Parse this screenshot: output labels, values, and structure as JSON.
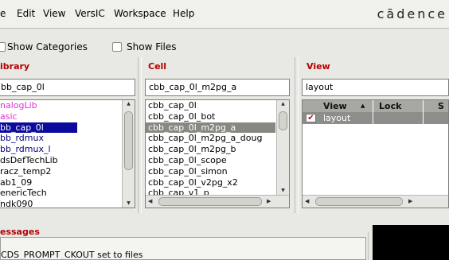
{
  "menubar": {
    "items": [
      "e",
      "Edit",
      "View",
      "VersIC",
      "Workspace",
      "Help"
    ],
    "brand": "cādence"
  },
  "options": {
    "show_categories": "Show Categories",
    "show_files": "Show Files"
  },
  "library": {
    "title": "ibrary",
    "value": "bb_cap_0l",
    "items": [
      "nalogLib",
      "asic",
      "bb_cap_0l",
      "bb_rdmux",
      "bb_rdmux_l",
      "dsDefTechLib",
      "racz_temp2",
      "ab1_09",
      "enericTech",
      "ndk090"
    ]
  },
  "cell": {
    "title": "Cell",
    "value": "cbb_cap_0l_m2pg_a",
    "items": [
      "cbb_cap_0l",
      "cbb_cap_0l_bot",
      "cbb_cap_0l_m2pg_a",
      "cbb_cap_0l_m2pg_a_doug",
      "cbb_cap_0l_m2pg_b",
      "cbb_cap_0l_scope",
      "cbb_cap_0l_simon",
      "cbb_cap_0l_v2pg_x2",
      "cbb_cap_v1_p"
    ]
  },
  "view": {
    "title": "View",
    "value": "layout",
    "columns": [
      "View",
      "Lock",
      "S"
    ],
    "rows": [
      {
        "view": "layout",
        "lock": "",
        "s": ""
      }
    ]
  },
  "messages": {
    "title": "essages",
    "line": "CDS_PROMPT_CKOUT set to files"
  },
  "colors": {
    "title_red": "#b50000",
    "select_blue": "#0a0a9c",
    "select_gray": "#878783",
    "pink": "#e030d8",
    "navy": "#000080"
  }
}
